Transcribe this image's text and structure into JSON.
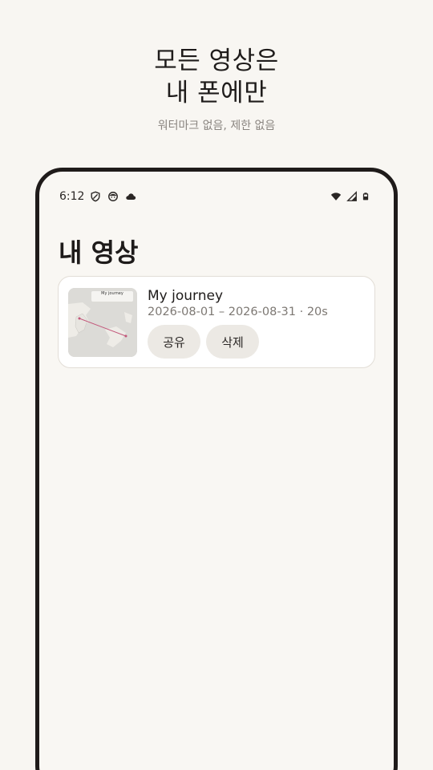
{
  "hero": {
    "title_line1": "모든 영상은",
    "title_line2": "내 폰에만",
    "subtitle": "워터마크 없음, 제한 없음"
  },
  "status_bar": {
    "time": "6:12",
    "left_icons": [
      "vpn-shield-icon",
      "face-notification-icon",
      "cloud-icon"
    ],
    "right_icons": [
      "wifi-icon",
      "cellular-signal-icon",
      "battery-icon"
    ]
  },
  "screen": {
    "title": "내 영상"
  },
  "videos": [
    {
      "title": "My journey",
      "meta": "2026-08-01 – 2026-08-31 · 20s",
      "thumbnail_label": "My journey",
      "share_label": "공유",
      "delete_label": "삭제"
    }
  ],
  "colors": {
    "background": "#f8f6f2",
    "phone_frame": "#1f1b1a",
    "card": "#ffffff",
    "pill_button": "#ece9e4",
    "route_line": "#c2577a"
  }
}
